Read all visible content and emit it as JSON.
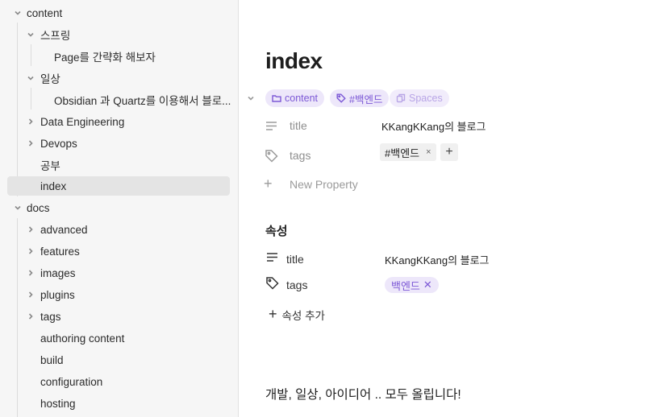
{
  "sidebar": {
    "items": [
      {
        "label": "content",
        "expanded": true
      },
      {
        "label": "스프링",
        "expanded": true
      },
      {
        "label": "Page를 간략화 해보자"
      },
      {
        "label": "일상",
        "expanded": true
      },
      {
        "label": "Obsidian 과 Quartz를 이용해서 블로..."
      },
      {
        "label": "Data Engineering",
        "expanded": false
      },
      {
        "label": "Devops",
        "expanded": false
      },
      {
        "label": "공부"
      },
      {
        "label": "index",
        "active": true
      },
      {
        "label": "docs",
        "expanded": true
      },
      {
        "label": "advanced",
        "expanded": false
      },
      {
        "label": "features",
        "expanded": false
      },
      {
        "label": "images",
        "expanded": false
      },
      {
        "label": "plugins",
        "expanded": false
      },
      {
        "label": "tags",
        "expanded": false
      },
      {
        "label": "authoring content"
      },
      {
        "label": "build"
      },
      {
        "label": "configuration"
      },
      {
        "label": "hosting"
      }
    ]
  },
  "main": {
    "title": "index",
    "meta_pills": {
      "folder": "content",
      "tag": "#백엔드",
      "spaces": "Spaces"
    },
    "properties": {
      "title_key": "title",
      "title_value": "KKangKKang의 블로그",
      "tags_key": "tags",
      "tags_value": "#백엔드",
      "tags_remove": "×",
      "add_tag": "+",
      "new_property": "New Property"
    },
    "section": {
      "heading": "속성",
      "title_key": "title",
      "title_value": "KKangKKang의 블로그",
      "tags_key": "tags",
      "tag_value": "백엔드",
      "tag_remove": "✕",
      "add_property": "속성 추가"
    },
    "body": "개발, 일상, 아이디어 .. 모두 올립니다!"
  },
  "colors": {
    "accent": "#7c58d6",
    "pill_bg": "#ede7fa",
    "sidebar_bg": "#f6f6f6"
  }
}
